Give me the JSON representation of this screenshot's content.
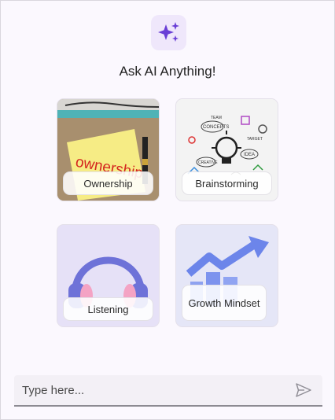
{
  "header": {
    "title": "Ask AI Anything!",
    "logo_icon": "sparkle-icon",
    "accent_color": "#6a3fd6",
    "logo_bg": "#efe7fb"
  },
  "cards": [
    {
      "label": "Ownership",
      "image": "sticky-note-ownership"
    },
    {
      "label": "Brainstorming",
      "image": "lightbulb-doodles"
    },
    {
      "label": "Listening",
      "image": "headphones"
    },
    {
      "label": "Growth Mindset",
      "image": "rising-bar-chart-arrow"
    }
  ],
  "cards_image_text": {
    "ownership_note": "ownership",
    "doodle_words": [
      "TEAM",
      "CONCEPTS",
      "TARGET",
      "IDEA",
      "CREATIVE"
    ]
  },
  "input": {
    "placeholder": "Type here...",
    "value": "",
    "send_icon": "send-icon"
  }
}
